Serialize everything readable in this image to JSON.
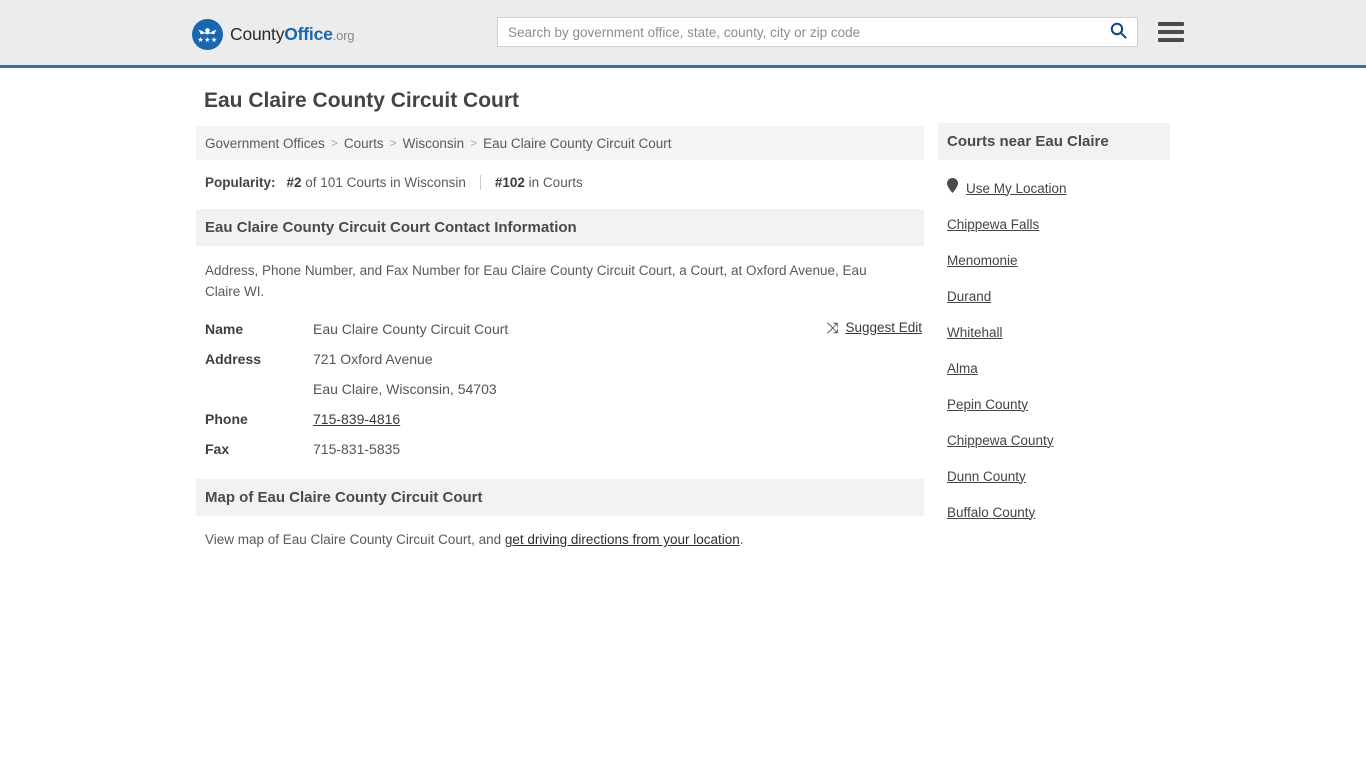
{
  "header": {
    "logo": {
      "part1": "County",
      "part2": "Office",
      "part3": ".org",
      "icon": "eagle-seal-icon"
    },
    "search": {
      "placeholder": "Search by government office, state, county, city or zip code",
      "value": "",
      "icon": "search-icon"
    },
    "menu": {
      "icon": "hamburger-menu-icon",
      "label": "Menu"
    }
  },
  "main": {
    "page_title": "Eau Claire County Circuit Court",
    "breadcrumb": [
      "Government Offices",
      "Courts",
      "Wisconsin",
      "Eau Claire County Circuit Court"
    ],
    "breadcrumb_separator": ">",
    "popularity": {
      "label": "Popularity:",
      "rank_state": "#2",
      "rank_state_text": " of 101 Courts in Wisconsin",
      "rank_overall": "#102",
      "rank_overall_text": " in Courts"
    },
    "contact": {
      "section_title": "Eau Claire County Circuit Court Contact Information",
      "description": "Address, Phone Number, and Fax Number for Eau Claire County Circuit Court, a Court, at Oxford Avenue, Eau Claire WI.",
      "suggest_edit": {
        "label": "Suggest Edit",
        "icon": "edit-pencil-icon",
        "glyph": "⤨"
      },
      "rows": [
        {
          "key": "Name",
          "value": "Eau Claire County Circuit Court"
        },
        {
          "key": "Address",
          "value": "721 Oxford Avenue"
        },
        {
          "key": "",
          "value": "Eau Claire, Wisconsin, 54703"
        },
        {
          "key": "Phone",
          "value": "715-839-4816"
        },
        {
          "key": "Fax",
          "value": "715-831-5835"
        }
      ]
    },
    "map": {
      "section_title": "Map of Eau Claire County Circuit Court",
      "description_before": "View map of Eau Claire County Circuit Court, and ",
      "link": "get driving directions from your location",
      "description_after": "."
    }
  },
  "rail": {
    "title": "Courts near Eau Claire",
    "use_my_location": {
      "label": "Use My Location",
      "icon": "map-pin-icon"
    },
    "items": [
      "Chippewa Falls",
      "Menomonie",
      "Durand",
      "Whitehall",
      "Alma",
      "Pepin County",
      "Chippewa County",
      "Dunn County",
      "Buffalo County"
    ]
  },
  "colors": {
    "brand_blue": "#1b66b0",
    "header_bg": "#ececec",
    "header_rule": "#36709f",
    "section_bg": "#f2f2f2",
    "text": "#555555"
  }
}
